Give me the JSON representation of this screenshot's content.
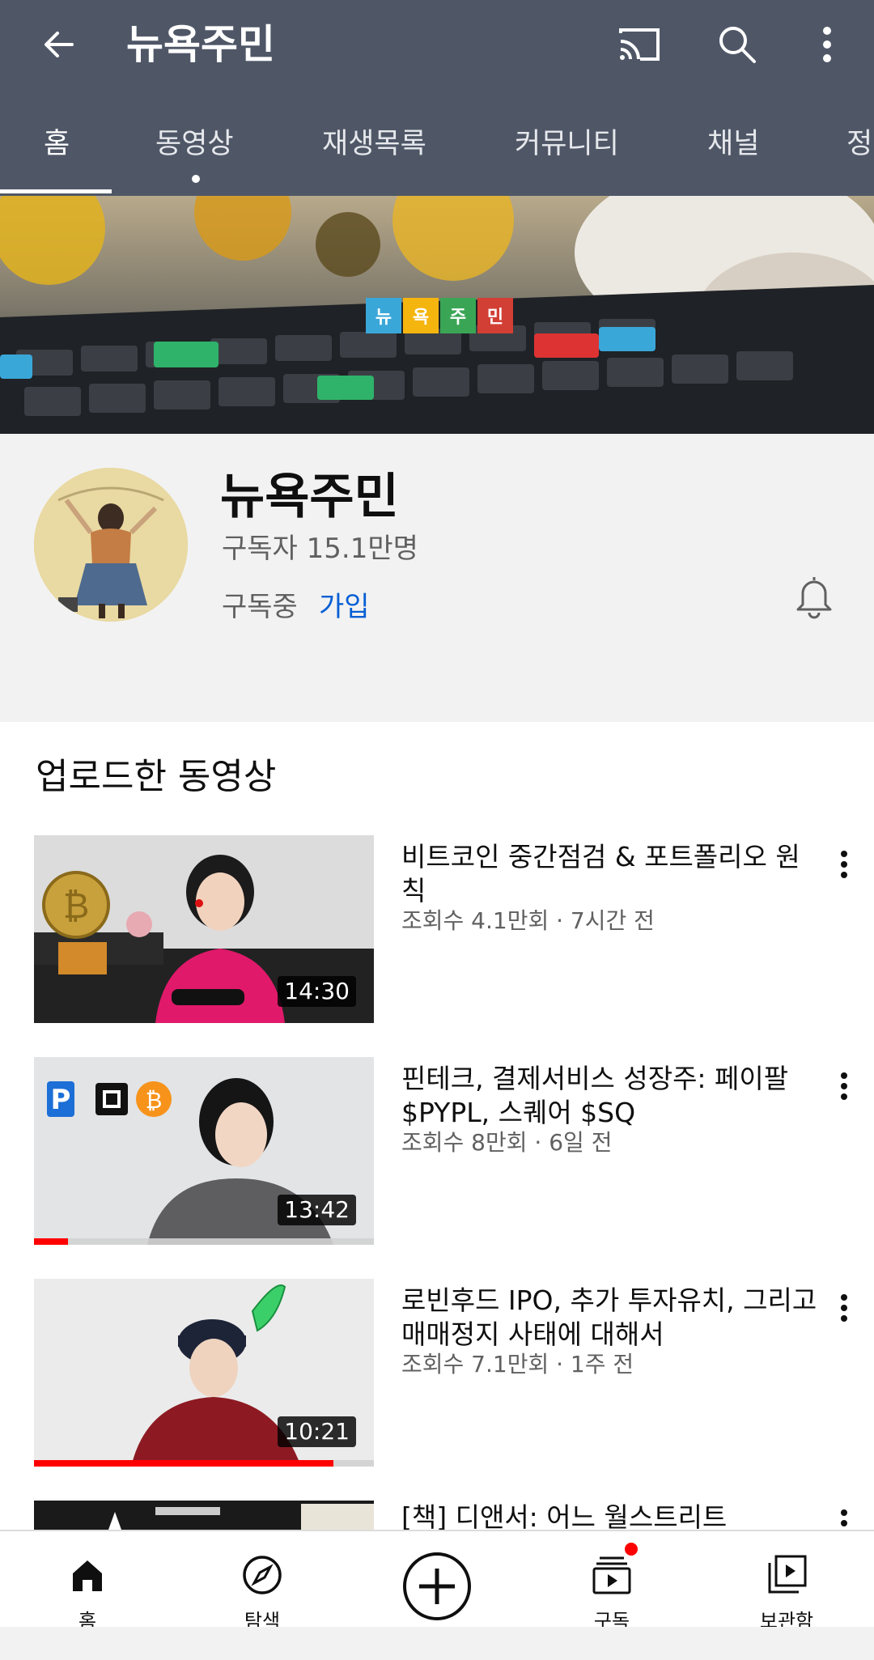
{
  "appbar": {
    "title": "뉴욕주민",
    "icons": {
      "back": "arrow-left-icon",
      "cast": "cast-icon",
      "search": "search-icon",
      "more": "more-vertical-icon"
    }
  },
  "tabs": [
    {
      "label": "홈",
      "active": true
    },
    {
      "label": "동영상",
      "active": false
    },
    {
      "label": "재생목록",
      "active": false
    },
    {
      "label": "커뮤니티",
      "active": false
    },
    {
      "label": "채널",
      "active": false
    },
    {
      "label": "정",
      "active": false
    }
  ],
  "banner": {
    "logo": [
      "뉴",
      "욕",
      "주",
      "민"
    ],
    "logo_colors": [
      "#3aa7d9",
      "#f5b50f",
      "#3aa655",
      "#d23f35"
    ]
  },
  "channel": {
    "name": "뉴욕주민",
    "subscribers": "구독자 15.1만명",
    "status": "구독중",
    "join": "가입"
  },
  "section": {
    "title": "업로드한 동영상"
  },
  "videos": [
    {
      "title": "비트코인 중간점검 & 포트폴리오 원칙",
      "meta": "조회수 4.1만회 · 7시간 전",
      "duration": "14:30",
      "progress": 0
    },
    {
      "title": "핀테크, 결제서비스 성장주: 페이팔 $PYPL, 스퀘어 $SQ",
      "meta": "조회수 8만회 · 6일 전",
      "duration": "13:42",
      "progress": 0.1
    },
    {
      "title": "로빈후드 IPO, 추가 투자유치, 그리고 매매정지 사태에 대해서",
      "meta": "조회수 7.1만회 · 1주 전",
      "duration": "10:21",
      "progress": 0.88
    },
    {
      "title": "[책] 디앤서: 어느 월스트리트",
      "meta": "",
      "duration": "",
      "progress": 0
    }
  ],
  "bottom_nav": [
    {
      "label": "홈",
      "icon": "home-icon"
    },
    {
      "label": "탐색",
      "icon": "explore-icon"
    },
    {
      "label": "",
      "icon": "create-icon"
    },
    {
      "label": "구독",
      "icon": "subscriptions-icon",
      "badge": true
    },
    {
      "label": "보관함",
      "icon": "library-icon"
    }
  ],
  "colors": {
    "appbar": "#4f5767",
    "link": "#065fd4",
    "progress": "#ff0000"
  }
}
